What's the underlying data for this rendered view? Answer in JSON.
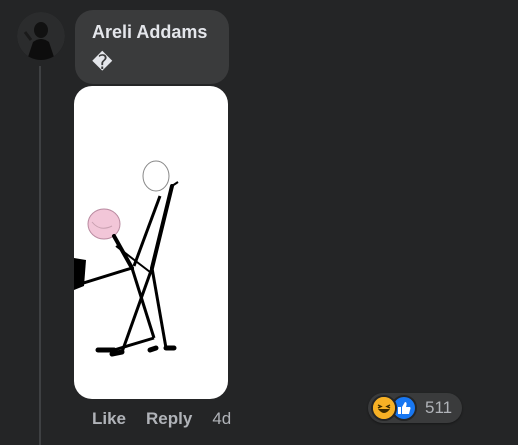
{
  "comment": {
    "author": "Areli Addams",
    "text": "�",
    "time": "4d"
  },
  "actions": {
    "like_label": "Like",
    "reply_label": "Reply"
  },
  "reactions": {
    "icons": [
      "haha-icon",
      "like-icon"
    ],
    "count": "511",
    "colors": {
      "haha": "#f7b125",
      "like": "#1877f2"
    }
  },
  "colors": {
    "background": "#242526",
    "bubble": "#3a3b3c",
    "text": "#e4e6eb",
    "muted": "#b0b3b8"
  }
}
